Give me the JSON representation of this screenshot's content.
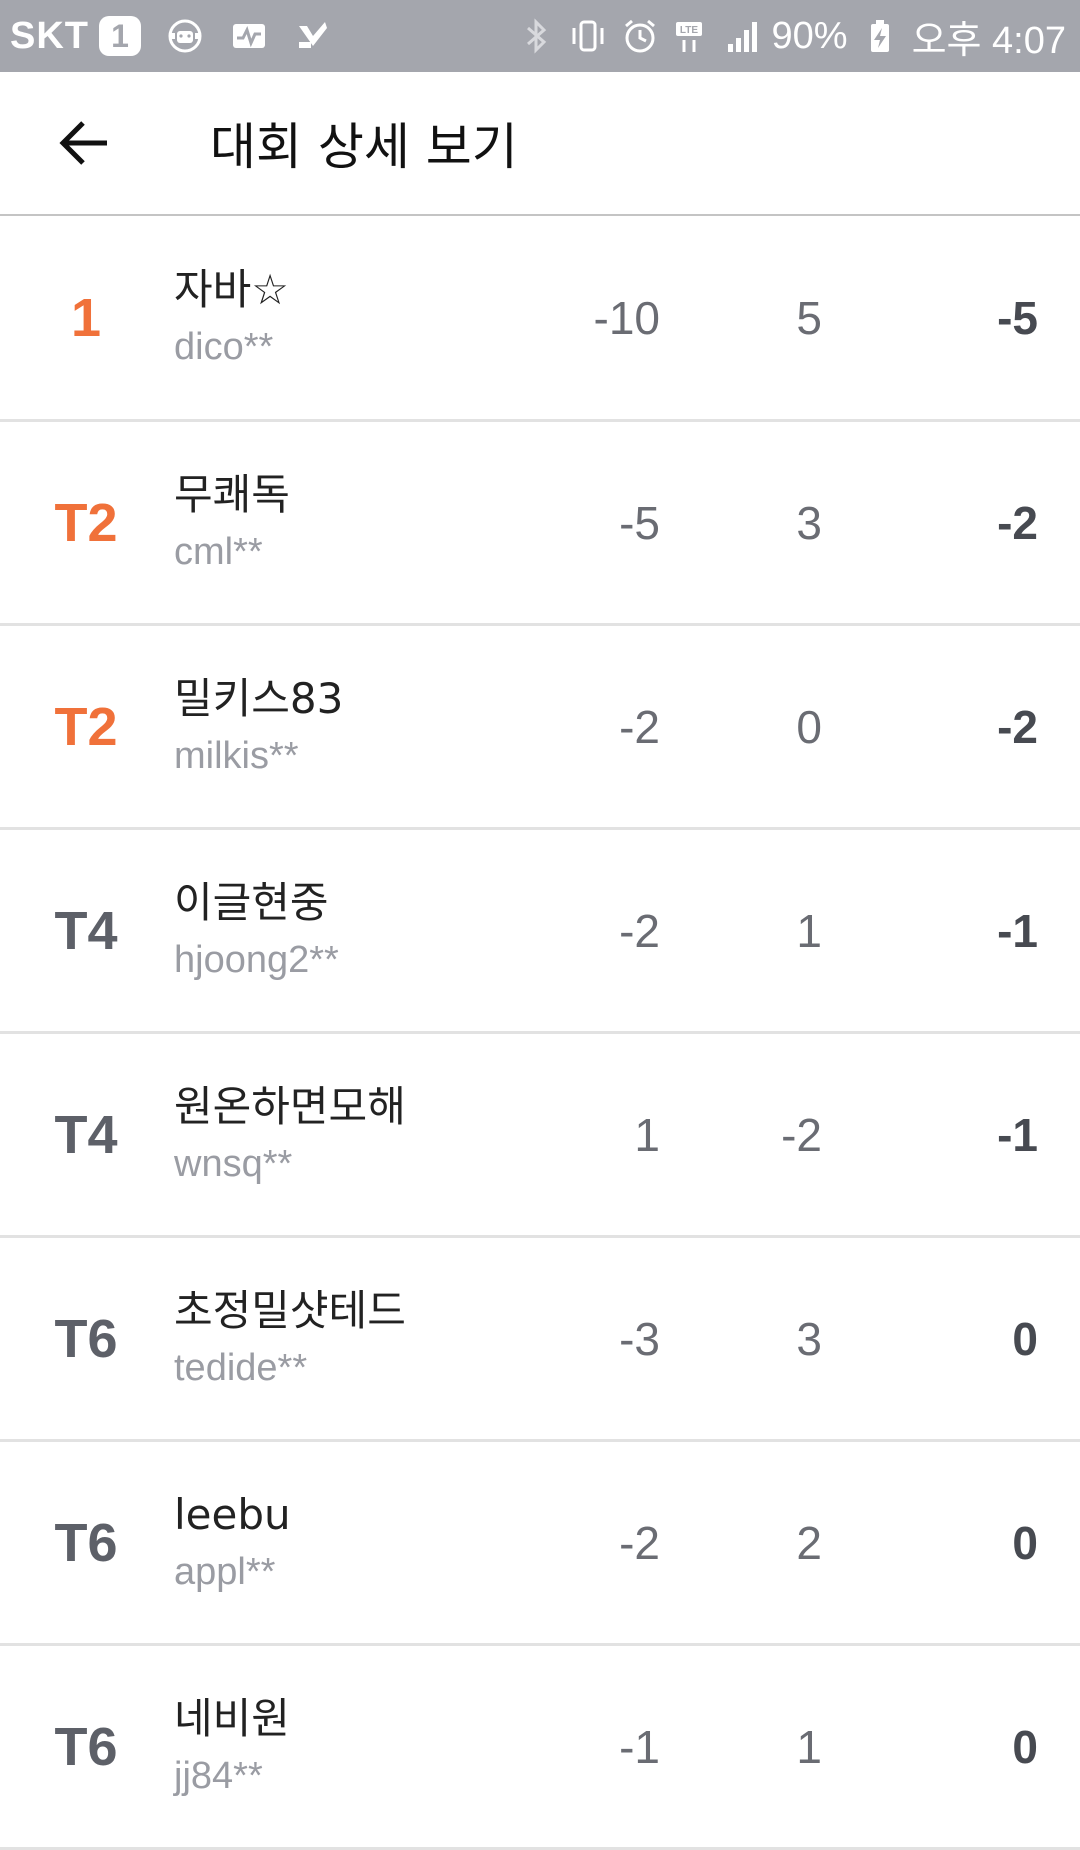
{
  "status_bar": {
    "carrier": "SKT",
    "sim_slot": "1",
    "battery": "90%",
    "time": "오후 4:07"
  },
  "app_bar": {
    "title": "대회 상세 보기"
  },
  "leaderboard": {
    "rows": [
      {
        "rank": "1",
        "name": "자바☆",
        "id": "dico**",
        "round1": "-10",
        "round2": "5",
        "total": "-5",
        "highlight": true
      },
      {
        "rank": "T2",
        "name": "무쾌독",
        "id": "cml**",
        "round1": "-5",
        "round2": "3",
        "total": "-2",
        "highlight": true
      },
      {
        "rank": "T2",
        "name": "밀키스83",
        "id": "milkis**",
        "round1": "-2",
        "round2": "0",
        "total": "-2",
        "highlight": true
      },
      {
        "rank": "T4",
        "name": "이글현중",
        "id": "hjoong2**",
        "round1": "-2",
        "round2": "1",
        "total": "-1",
        "highlight": false
      },
      {
        "rank": "T4",
        "name": "원온하면모해",
        "id": "wnsq**",
        "round1": "1",
        "round2": "-2",
        "total": "-1",
        "highlight": false
      },
      {
        "rank": "T6",
        "name": "초정밀샷테드",
        "id": "tedide**",
        "round1": "-3",
        "round2": "3",
        "total": "0",
        "highlight": false
      },
      {
        "rank": "T6",
        "name": "leebu",
        "id": "appl**",
        "round1": "-2",
        "round2": "2",
        "total": "0",
        "highlight": false
      },
      {
        "rank": "T6",
        "name": "네비원",
        "id": "jj84**",
        "round1": "-1",
        "round2": "1",
        "total": "0",
        "highlight": false
      }
    ]
  },
  "colors": {
    "status_bar": "#a4a6ad",
    "accent_rank": "#f0713a",
    "rank_default": "#5d6068",
    "divider": "#e2e2e2"
  }
}
